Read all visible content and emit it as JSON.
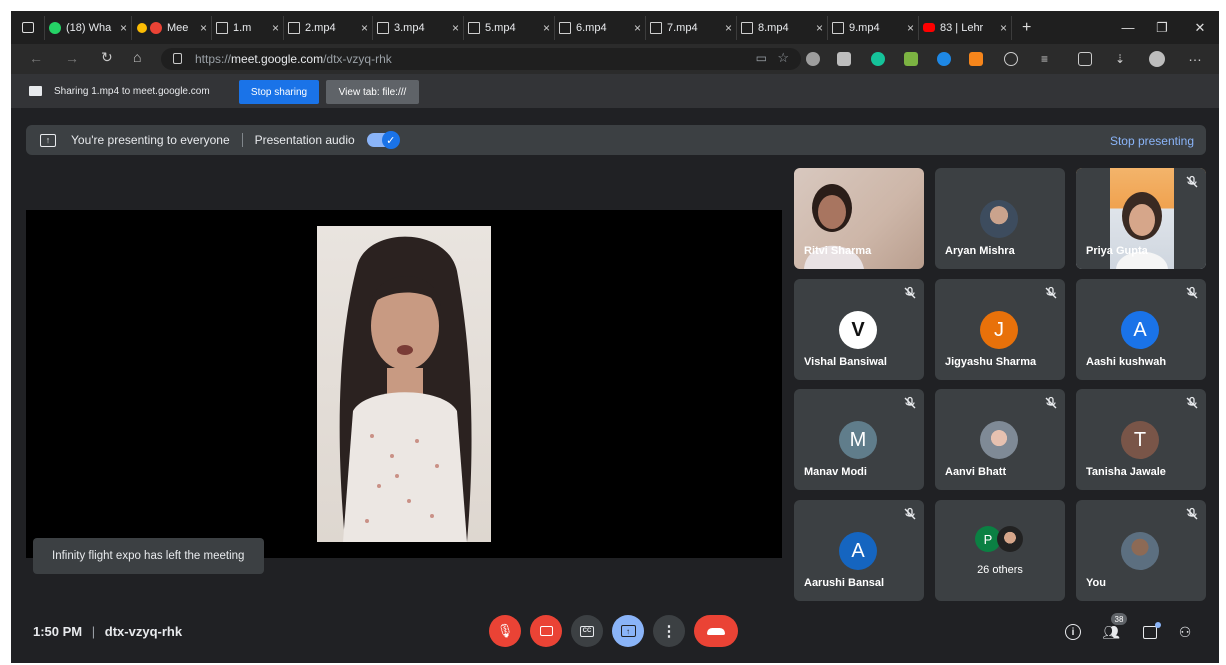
{
  "browser": {
    "tabs": [
      {
        "label": "(18) Wha",
        "icon": "whatsapp-icon"
      },
      {
        "label": "Mee",
        "icon": "meet-icon"
      },
      {
        "label": "1.m",
        "icon": "page-icon"
      },
      {
        "label": "2.mp4",
        "icon": "page-icon"
      },
      {
        "label": "3.mp4",
        "icon": "page-icon"
      },
      {
        "label": "5.mp4",
        "icon": "page-icon"
      },
      {
        "label": "6.mp4",
        "icon": "page-icon"
      },
      {
        "label": "7.mp4",
        "icon": "page-icon"
      },
      {
        "label": "8.mp4",
        "icon": "page-icon"
      },
      {
        "label": "9.mp4",
        "icon": "page-icon"
      },
      {
        "label": "83 | Lehr",
        "icon": "youtube-icon"
      }
    ],
    "url_prefix": "https://",
    "url_host": "meet.google.com",
    "url_path": "/dtx-vzyq-rhk"
  },
  "sharing_bar": {
    "text": "Sharing 1.mp4 to meet.google.com",
    "stop_label": "Stop sharing",
    "view_label": "View tab: file:///"
  },
  "banner": {
    "presenting_text": "You're presenting to everyone",
    "audio_label": "Presentation audio",
    "audio_on": true,
    "stop_label": "Stop presenting"
  },
  "toast": "Infinity flight expo has left the meeting",
  "participants": [
    {
      "name": "Ritvi Sharma",
      "kind": "video",
      "muted": false
    },
    {
      "name": "Aryan Mishra",
      "kind": "photo",
      "muted": false
    },
    {
      "name": "Priya Gupta",
      "kind": "video",
      "muted": true
    },
    {
      "name": "Vishal Bansiwal",
      "kind": "logo",
      "letter": "V",
      "muted": true
    },
    {
      "name": "Jigyashu Sharma",
      "kind": "letter",
      "letter": "J",
      "color": "#e8710a",
      "muted": true
    },
    {
      "name": "Aashi kushwah",
      "kind": "letter",
      "letter": "A",
      "color": "#1a73e8",
      "muted": true
    },
    {
      "name": "Manav Modi",
      "kind": "letter",
      "letter": "M",
      "color": "#607d8b",
      "muted": true
    },
    {
      "name": "Aanvi Bhatt",
      "kind": "photo",
      "muted": true
    },
    {
      "name": "Tanisha Jawale",
      "kind": "letter",
      "letter": "T",
      "color": "#795548",
      "muted": true
    },
    {
      "name": "Aarushi Bansal",
      "kind": "letter",
      "letter": "A",
      "color": "#1565c0",
      "muted": true
    },
    {
      "name": "26 others",
      "kind": "others",
      "letter": "P",
      "muted": false
    },
    {
      "name": "You",
      "kind": "photo",
      "muted": true
    }
  ],
  "footer": {
    "time": "1:50 PM",
    "separator": "|",
    "meeting_code": "dtx-vzyq-rhk",
    "people_count": "38"
  }
}
